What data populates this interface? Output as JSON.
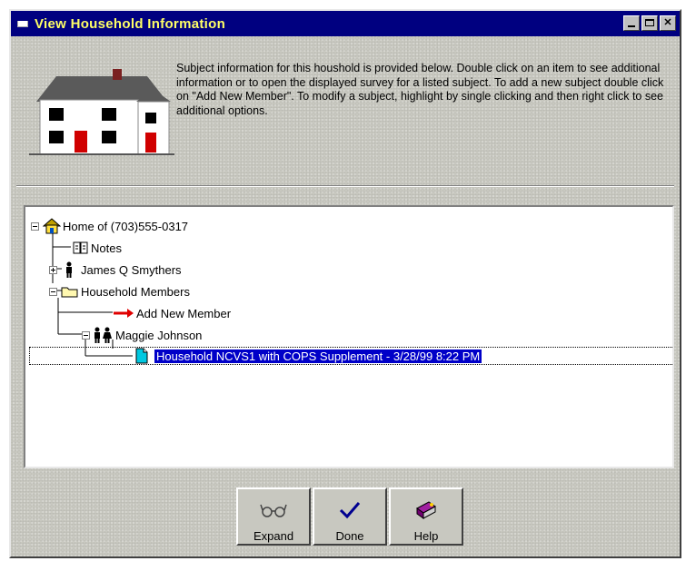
{
  "window": {
    "title": "View Household Information"
  },
  "intro": {
    "text": "Subject information for this houshold is provided below. Double click on an item to see additional information or to open the displayed survey for a listed subject. To add a new subject double click on \"Add New Member\". To modify a subject, highlight by single clicking and then right click to see additional options."
  },
  "tree": {
    "root": "Home of (703)555-0317",
    "notes": "Notes",
    "member1": "James Q Smythers",
    "household_members": "Household Members",
    "add_new": "Add New Member",
    "member2": "Maggie Johnson",
    "survey": "Household NCVS1 with COPS Supplement - 3/28/99 8:22 PM"
  },
  "buttons": {
    "expand": "Expand",
    "done": "Done",
    "help": "Help"
  },
  "icons": [
    "house-icon",
    "book-icon",
    "person-icon",
    "folder-icon",
    "red-arrow-icon",
    "people-icon",
    "document-icon",
    "glasses-icon",
    "checkmark-icon",
    "help-book-icon"
  ],
  "colors": {
    "titlebar": "#000080",
    "title_text": "#ffff66",
    "selection": "#0000c8",
    "arrow": "#e00000"
  }
}
